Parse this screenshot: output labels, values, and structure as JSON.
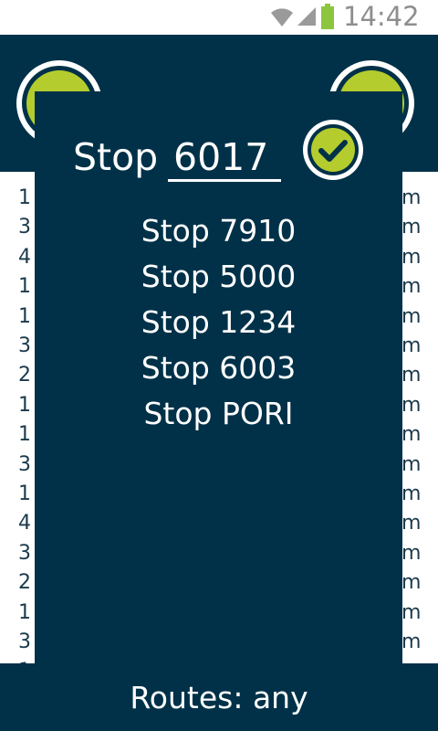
{
  "status_bar": {
    "time": "14:42",
    "icons": [
      "wifi-icon",
      "signal-icon",
      "battery-icon"
    ]
  },
  "header": {
    "left_button_icon": "calendar-icon",
    "right_button_icon": "refresh-icon"
  },
  "background_list": {
    "rows": [
      {
        "left": "1",
        "right": "m"
      },
      {
        "left": "3",
        "right": "m"
      },
      {
        "left": "4",
        "right": "m"
      },
      {
        "left": "1",
        "right": "m"
      },
      {
        "left": "1",
        "right": "m"
      },
      {
        "left": "3",
        "right": "m"
      },
      {
        "left": "2",
        "right": "m"
      },
      {
        "left": "1",
        "right": "m"
      },
      {
        "left": "1",
        "right": "m"
      },
      {
        "left": "3",
        "right": "m"
      },
      {
        "left": "1",
        "right": "m"
      },
      {
        "left": "4",
        "right": "m"
      },
      {
        "left": "3",
        "right": "m"
      },
      {
        "left": "2",
        "right": "m"
      },
      {
        "left": "1",
        "right": "m"
      },
      {
        "left": "3",
        "right": "m"
      },
      {
        "left": "1",
        "right": "m"
      }
    ]
  },
  "footer": {
    "routes_text": "Routes: any"
  },
  "stop_picker": {
    "label": "Stop",
    "input_value": "6017",
    "confirm_icon": "checkmark-icon",
    "options": [
      "Stop 7910",
      "Stop 5000",
      "Stop 1234",
      "Stop 6003",
      "Stop PORI"
    ]
  },
  "colors": {
    "primary_dark": "#003148",
    "accent_green": "#b5cc2e",
    "status_gray": "#8e8e8e"
  }
}
